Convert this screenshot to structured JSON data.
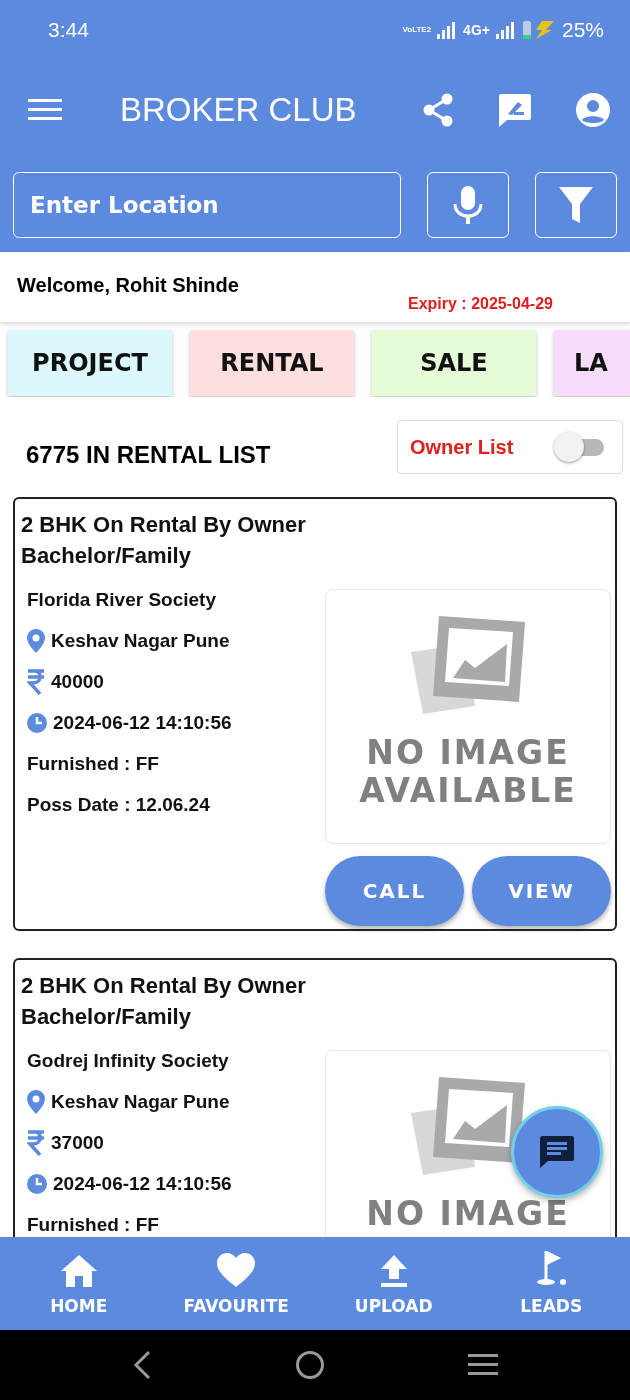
{
  "status_bar": {
    "time": "3:44",
    "volte": "VoLTE2",
    "network": "4G+",
    "battery": "25%"
  },
  "app_bar": {
    "title": "BROKER CLUB"
  },
  "search": {
    "placeholder": "Enter Location"
  },
  "welcome": {
    "greeting": "Welcome, Rohit Shinde",
    "expiry": "Expiry : 2025-04-29"
  },
  "categories": [
    {
      "label": "PROJECT",
      "color": "#dcf8fc"
    },
    {
      "label": "RENTAL",
      "color": "#fde0de"
    },
    {
      "label": "SALE",
      "color": "#e6fcd8"
    },
    {
      "label": "LA",
      "color": "#f8dcfc"
    }
  ],
  "list_header": {
    "count_text": "6775 IN RENTAL LIST",
    "owner_list": {
      "label": "Owner List",
      "on": false
    }
  },
  "listings": [
    {
      "title": "2 BHK On Rental By Owner",
      "subtitle": "Bachelor/Family",
      "society": "Florida River Society",
      "location": "Keshav Nagar Pune",
      "price": "40000",
      "date": "2024-06-12 14:10:56",
      "furnished": "Furnished : FF",
      "poss_date": "Poss Date : 12.06.24",
      "no_image_text": [
        "NO IMAGE",
        "AVAILABLE"
      ],
      "buttons": [
        "CALL",
        "VIEW"
      ]
    },
    {
      "title": "2 BHK On Rental By Owner",
      "subtitle": "Bachelor/Family",
      "society": "Godrej Infinity Society",
      "location": "Keshav Nagar Pune",
      "price": "37000",
      "date": "2024-06-12 14:10:56",
      "furnished": "Furnished : FF",
      "no_image_text": [
        "NO IMAGE"
      ]
    }
  ],
  "bottom_nav": [
    "HOME",
    "FAVOURITE",
    "UPLOAD",
    "LEADS"
  ]
}
